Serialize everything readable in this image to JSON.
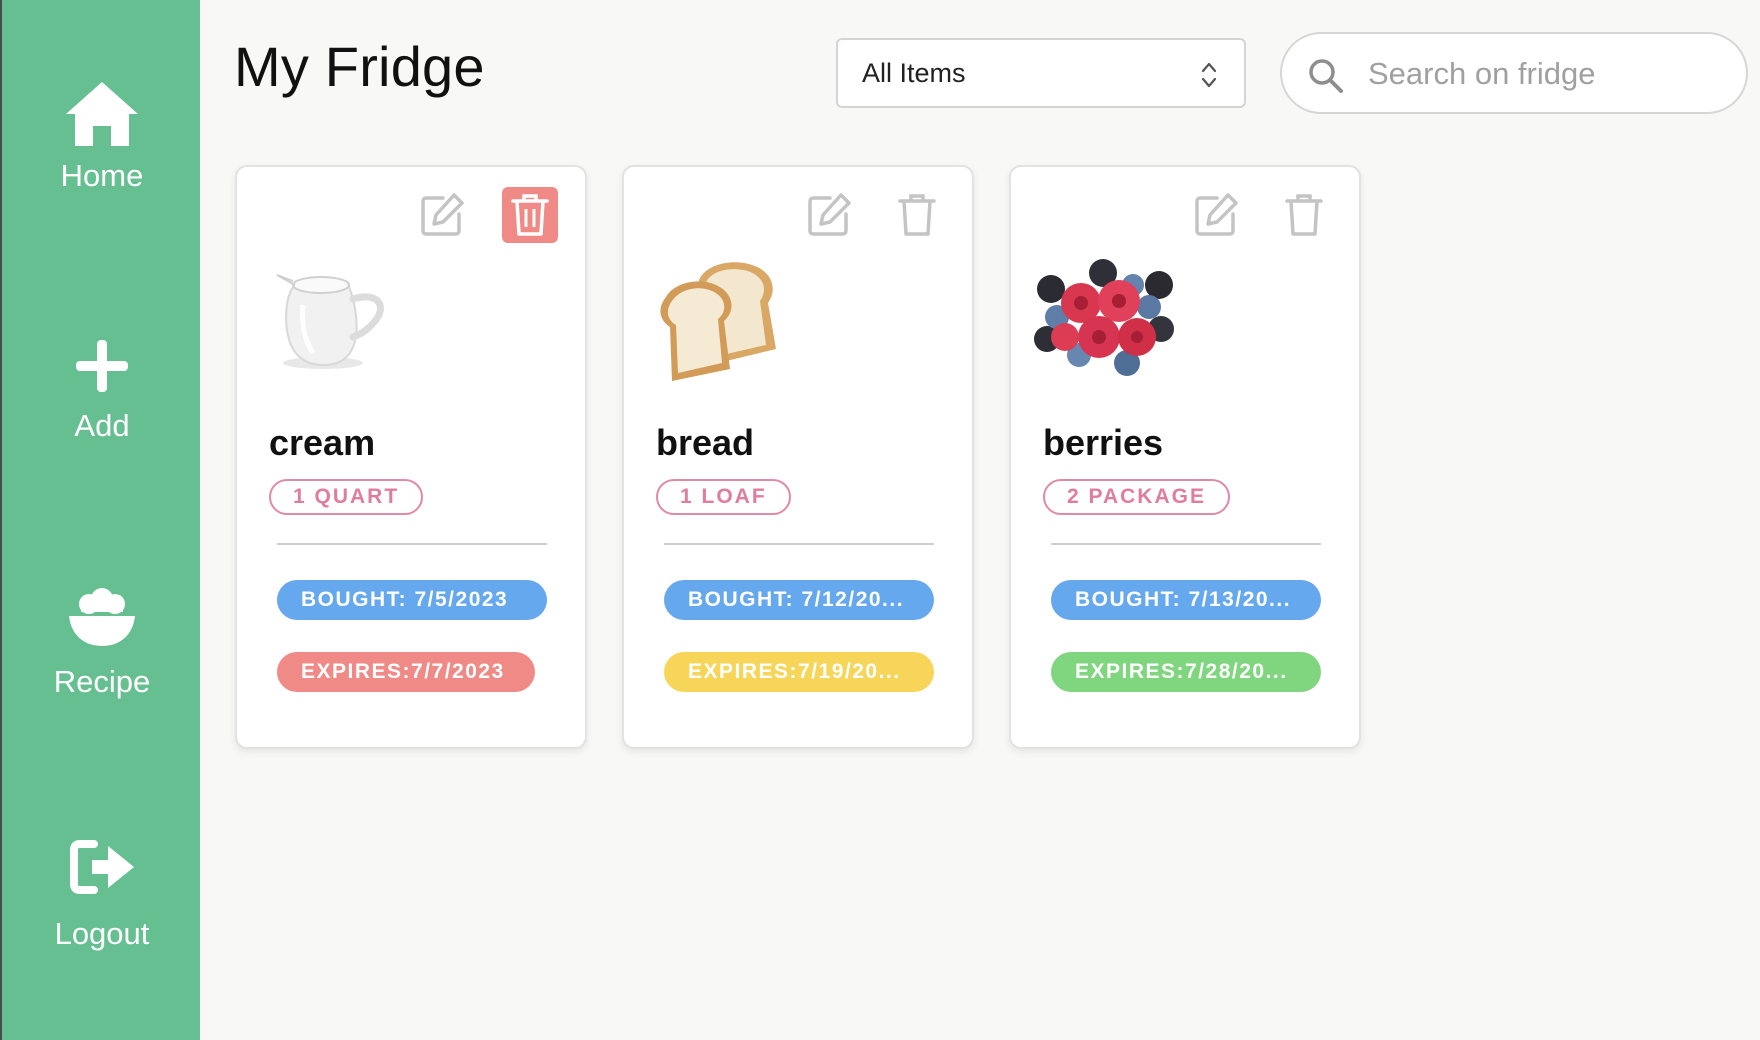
{
  "sidebar": {
    "items": [
      {
        "label": "Home",
        "icon": "home-icon"
      },
      {
        "label": "Add",
        "icon": "plus-icon"
      },
      {
        "label": "Recipe",
        "icon": "bowl-icon"
      },
      {
        "label": "Logout",
        "icon": "logout-icon"
      }
    ]
  },
  "header": {
    "title": "My Fridge",
    "filter": {
      "selected": "All Items"
    },
    "search": {
      "placeholder": "Search on fridge"
    }
  },
  "cards": [
    {
      "name": "cream",
      "quantity": "1 QUART",
      "bought": "BOUGHT: 7/5/2023",
      "expires": "EXPIRES:7/7/2023",
      "image": "cream-pitcher-image",
      "expires_color": "#ef8a86",
      "delete_highlighted": true
    },
    {
      "name": "bread",
      "quantity": "1 LOAF",
      "bought": "BOUGHT: 7/12/20...",
      "expires": "EXPIRES:7/19/20...",
      "image": "bread-slices-image",
      "expires_color": "#f6d559",
      "delete_highlighted": false
    },
    {
      "name": "berries",
      "quantity": "2 PACKAGE",
      "bought": "BOUGHT: 7/13/20...",
      "expires": "EXPIRES:7/28/20...",
      "image": "berries-image",
      "expires_color": "#7fd67f",
      "delete_highlighted": false
    }
  ],
  "colors": {
    "sidebar": "#66bf91",
    "bought_badge": "#65a8ee",
    "quantity_badge": "#e07c9d"
  }
}
